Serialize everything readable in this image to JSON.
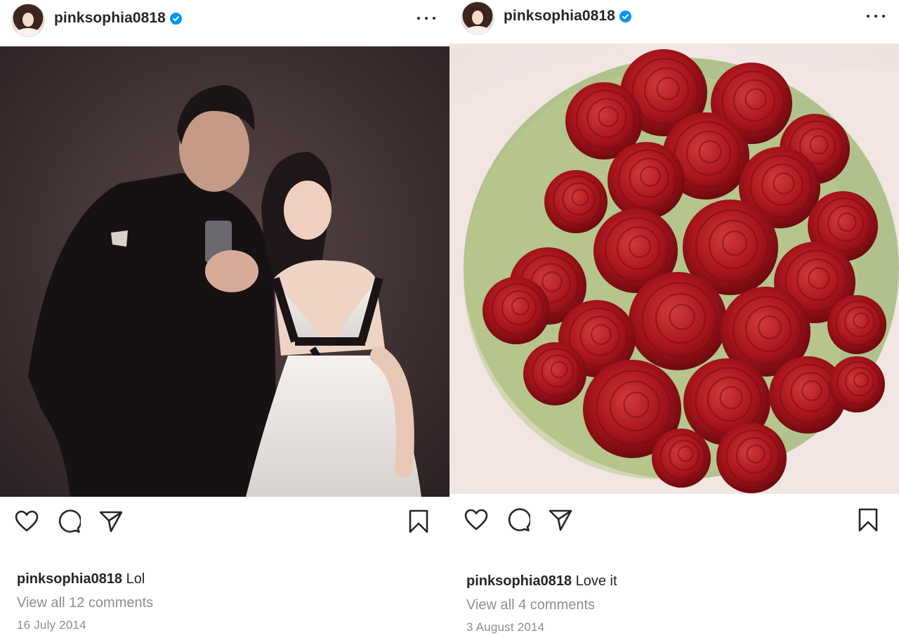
{
  "posts": [
    {
      "username": "pinksophia0818",
      "caption_user": "pinksophia0818",
      "caption_text": "Lol",
      "comments_link": "View all 12 comments",
      "date": "16 July 2014",
      "photo_description_icon": "selfie-photo"
    },
    {
      "username": "pinksophia0818",
      "caption_user": "pinksophia0818",
      "caption_text": "Love it",
      "comments_link": "View all 4 comments",
      "date": "3 August 2014",
      "photo_description_icon": "rose-bouquet-photo"
    }
  ],
  "icons": {
    "like": "heart-icon",
    "comment": "comment-bubble-icon",
    "share": "paper-plane-icon",
    "save": "bookmark-icon",
    "more": "more-options-icon",
    "verified": "verified-badge-icon"
  },
  "colors": {
    "text": "#262626",
    "secondary_text": "#8e8e8e",
    "verified_blue": "#0095f6",
    "background": "#ffffff"
  }
}
